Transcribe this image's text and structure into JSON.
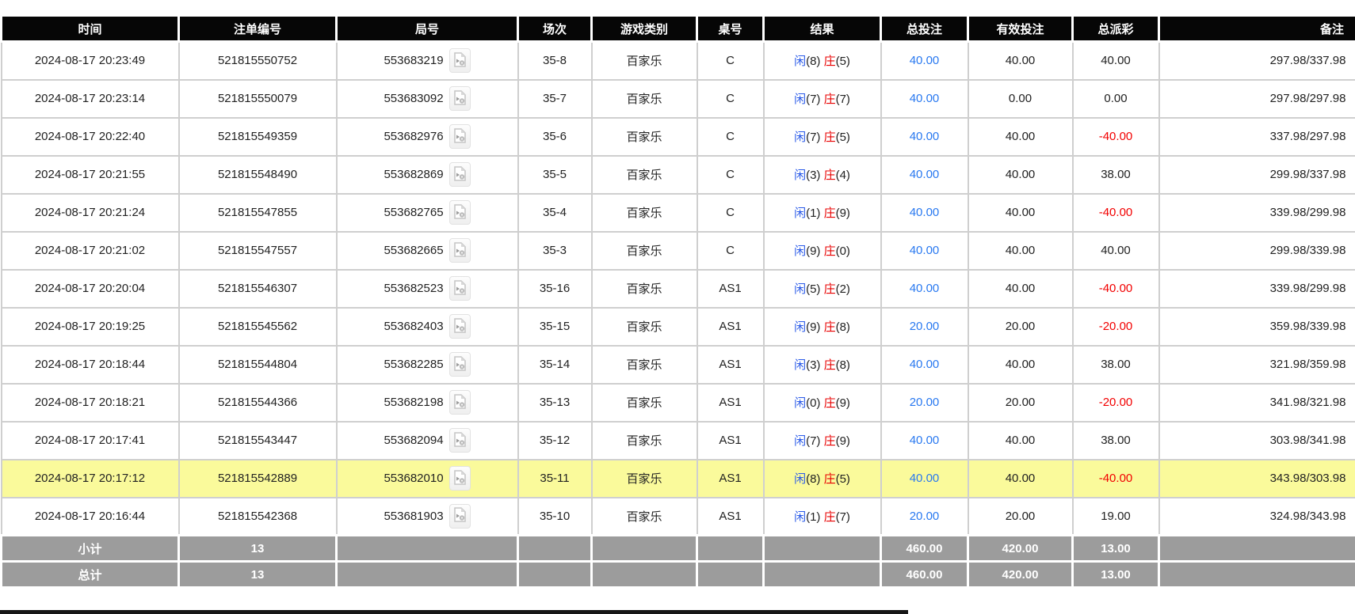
{
  "table": {
    "columns": [
      {
        "key": "time",
        "label": "时间"
      },
      {
        "key": "bet_id",
        "label": "注单编号"
      },
      {
        "key": "round",
        "label": "局号"
      },
      {
        "key": "session",
        "label": "场次"
      },
      {
        "key": "game_type",
        "label": "游戏类别"
      },
      {
        "key": "table_no",
        "label": "桌号"
      },
      {
        "key": "result",
        "label": "结果"
      },
      {
        "key": "total_bet",
        "label": "总投注"
      },
      {
        "key": "valid_bet",
        "label": "有效投注"
      },
      {
        "key": "payout",
        "label": "总派彩"
      },
      {
        "key": "remark",
        "label": "备注"
      }
    ],
    "result_labels": {
      "player": "闲",
      "banker": "庄"
    },
    "rows": [
      {
        "time": "2024-08-17 20:23:49",
        "bet_id": "521815550752",
        "round": "553683219",
        "session": "35-8",
        "game_type": "百家乐",
        "table_no": "C",
        "player": "8",
        "banker": "5",
        "total_bet": "40.00",
        "valid_bet": "40.00",
        "payout": "40.00",
        "remark": "297.98/337.98",
        "highlight": false
      },
      {
        "time": "2024-08-17 20:23:14",
        "bet_id": "521815550079",
        "round": "553683092",
        "session": "35-7",
        "game_type": "百家乐",
        "table_no": "C",
        "player": "7",
        "banker": "7",
        "total_bet": "40.00",
        "valid_bet": "0.00",
        "payout": "0.00",
        "remark": "297.98/297.98",
        "highlight": false
      },
      {
        "time": "2024-08-17 20:22:40",
        "bet_id": "521815549359",
        "round": "553682976",
        "session": "35-6",
        "game_type": "百家乐",
        "table_no": "C",
        "player": "7",
        "banker": "5",
        "total_bet": "40.00",
        "valid_bet": "40.00",
        "payout": "-40.00",
        "remark": "337.98/297.98",
        "highlight": false
      },
      {
        "time": "2024-08-17 20:21:55",
        "bet_id": "521815548490",
        "round": "553682869",
        "session": "35-5",
        "game_type": "百家乐",
        "table_no": "C",
        "player": "3",
        "banker": "4",
        "total_bet": "40.00",
        "valid_bet": "40.00",
        "payout": "38.00",
        "remark": "299.98/337.98",
        "highlight": false
      },
      {
        "time": "2024-08-17 20:21:24",
        "bet_id": "521815547855",
        "round": "553682765",
        "session": "35-4",
        "game_type": "百家乐",
        "table_no": "C",
        "player": "1",
        "banker": "9",
        "total_bet": "40.00",
        "valid_bet": "40.00",
        "payout": "-40.00",
        "remark": "339.98/299.98",
        "highlight": false
      },
      {
        "time": "2024-08-17 20:21:02",
        "bet_id": "521815547557",
        "round": "553682665",
        "session": "35-3",
        "game_type": "百家乐",
        "table_no": "C",
        "player": "9",
        "banker": "0",
        "total_bet": "40.00",
        "valid_bet": "40.00",
        "payout": "40.00",
        "remark": "299.98/339.98",
        "highlight": false
      },
      {
        "time": "2024-08-17 20:20:04",
        "bet_id": "521815546307",
        "round": "553682523",
        "session": "35-16",
        "game_type": "百家乐",
        "table_no": "AS1",
        "player": "5",
        "banker": "2",
        "total_bet": "40.00",
        "valid_bet": "40.00",
        "payout": "-40.00",
        "remark": "339.98/299.98",
        "highlight": false
      },
      {
        "time": "2024-08-17 20:19:25",
        "bet_id": "521815545562",
        "round": "553682403",
        "session": "35-15",
        "game_type": "百家乐",
        "table_no": "AS1",
        "player": "9",
        "banker": "8",
        "total_bet": "20.00",
        "valid_bet": "20.00",
        "payout": "-20.00",
        "remark": "359.98/339.98",
        "highlight": false
      },
      {
        "time": "2024-08-17 20:18:44",
        "bet_id": "521815544804",
        "round": "553682285",
        "session": "35-14",
        "game_type": "百家乐",
        "table_no": "AS1",
        "player": "3",
        "banker": "8",
        "total_bet": "40.00",
        "valid_bet": "40.00",
        "payout": "38.00",
        "remark": "321.98/359.98",
        "highlight": false
      },
      {
        "time": "2024-08-17 20:18:21",
        "bet_id": "521815544366",
        "round": "553682198",
        "session": "35-13",
        "game_type": "百家乐",
        "table_no": "AS1",
        "player": "0",
        "banker": "9",
        "total_bet": "20.00",
        "valid_bet": "20.00",
        "payout": "-20.00",
        "remark": "341.98/321.98",
        "highlight": false
      },
      {
        "time": "2024-08-17 20:17:41",
        "bet_id": "521815543447",
        "round": "553682094",
        "session": "35-12",
        "game_type": "百家乐",
        "table_no": "AS1",
        "player": "7",
        "banker": "9",
        "total_bet": "40.00",
        "valid_bet": "40.00",
        "payout": "38.00",
        "remark": "303.98/341.98",
        "highlight": false
      },
      {
        "time": "2024-08-17 20:17:12",
        "bet_id": "521815542889",
        "round": "553682010",
        "session": "35-11",
        "game_type": "百家乐",
        "table_no": "AS1",
        "player": "8",
        "banker": "5",
        "total_bet": "40.00",
        "valid_bet": "40.00",
        "payout": "-40.00",
        "remark": "343.98/303.98",
        "highlight": true
      },
      {
        "time": "2024-08-17 20:16:44",
        "bet_id": "521815542368",
        "round": "553681903",
        "session": "35-10",
        "game_type": "百家乐",
        "table_no": "AS1",
        "player": "1",
        "banker": "7",
        "total_bet": "20.00",
        "valid_bet": "20.00",
        "payout": "19.00",
        "remark": "324.98/343.98",
        "highlight": false
      }
    ],
    "summary_rows": [
      {
        "label": "小计",
        "count": "13",
        "total_bet": "460.00",
        "valid_bet": "420.00",
        "payout": "13.00"
      },
      {
        "label": "总计",
        "count": "13",
        "total_bet": "460.00",
        "valid_bet": "420.00",
        "payout": "13.00"
      }
    ],
    "icons": {
      "round_replay": "video-file-icon"
    }
  },
  "colors": {
    "header_bg": "#060606",
    "header_text": "#ffffff",
    "grid_line": "#cfcfcf",
    "highlight_row": "#fafa9b",
    "summary_bg": "#9c9c9c",
    "amount_blue": "#2878f0",
    "player_blue": "#2a5ae8",
    "banker_red": "#e80000",
    "negative_red": "#f20000"
  }
}
